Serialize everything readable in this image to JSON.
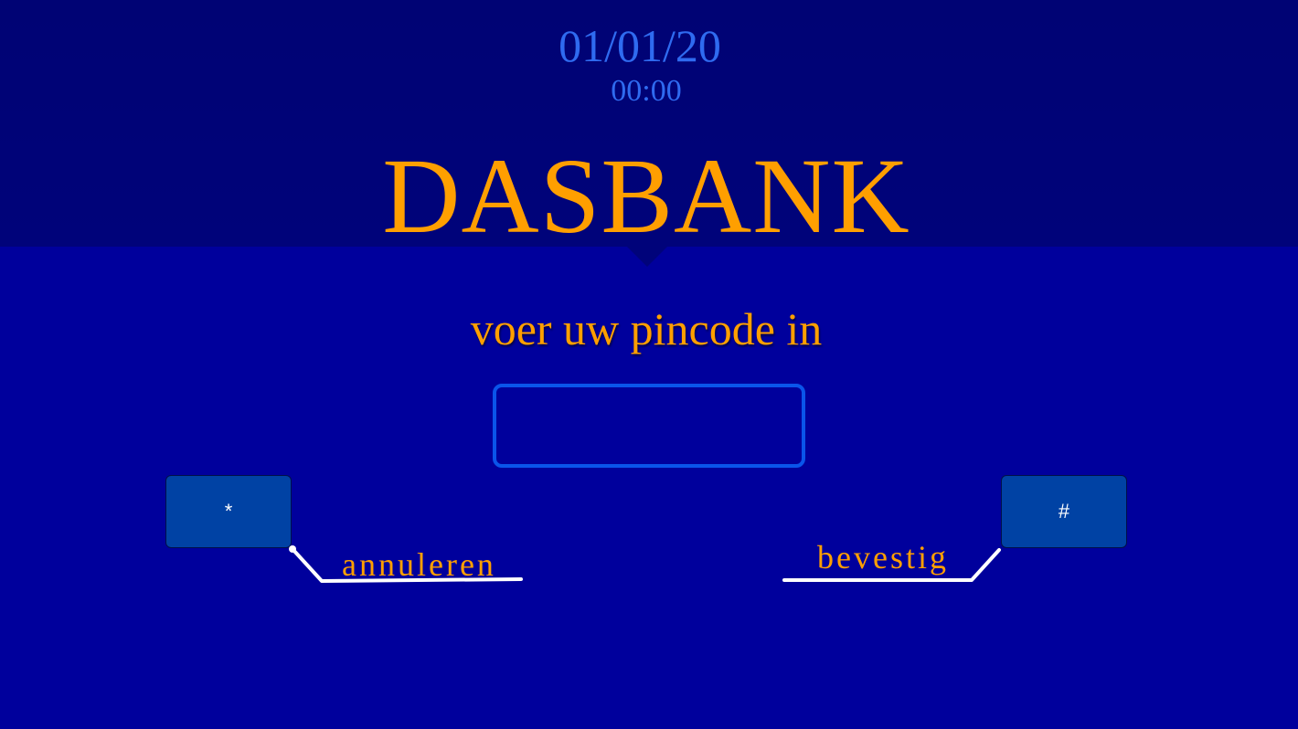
{
  "header": {
    "date": "01/01/20",
    "time": "00:00",
    "brand": "DASBANK"
  },
  "prompt": "voer uw pincode in",
  "pin": {
    "value": ""
  },
  "keys": {
    "cancel_key": "*",
    "confirm_key": "#"
  },
  "actions": {
    "cancel_label": "annuleren",
    "confirm_label": "bevestig"
  },
  "colors": {
    "background": "#00009c",
    "header": "#00037a",
    "accent": "#ff9f00",
    "clock": "#2f6bf0",
    "input_border": "#0a55ea",
    "key": "#0042a4"
  }
}
